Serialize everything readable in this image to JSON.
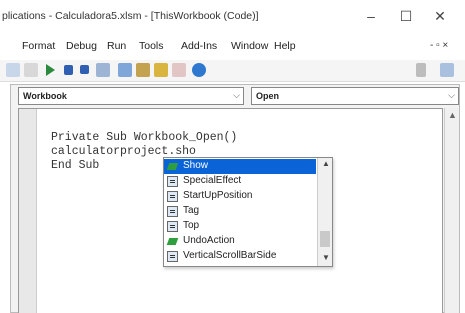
{
  "window": {
    "title": "plications - Calculadora5.xlsm - [ThisWorkbook (Code)]",
    "minimize": "–",
    "maximize": "☐",
    "close": "✕"
  },
  "menu": {
    "items": [
      "Format",
      "Debug",
      "Run",
      "Tools",
      "Add-Ins",
      "Window",
      "Help"
    ],
    "mdi_controls": "- ▫ ×"
  },
  "toolbar": {
    "icons": [
      "undo-icon",
      "redo-icon",
      "run-icon",
      "break-icon",
      "reset-icon",
      "design-mode-icon",
      "project-explorer-icon",
      "properties-icon",
      "object-browser-icon",
      "toolbox-icon",
      "help-icon"
    ]
  },
  "code_window": {
    "object_combo": "Workbook",
    "procedure_combo": "Open",
    "lines": [
      "Private Sub Workbook_Open()",
      "calculatorproject.sho",
      "End Sub"
    ]
  },
  "intellisense": {
    "items": [
      {
        "label": "Show",
        "kind": "method",
        "selected": true
      },
      {
        "label": "SpecialEffect",
        "kind": "property",
        "selected": false
      },
      {
        "label": "StartUpPosition",
        "kind": "property",
        "selected": false
      },
      {
        "label": "Tag",
        "kind": "property",
        "selected": false
      },
      {
        "label": "Top",
        "kind": "property",
        "selected": false
      },
      {
        "label": "UndoAction",
        "kind": "method",
        "selected": false
      },
      {
        "label": "VerticalScrollBarSide",
        "kind": "property",
        "selected": false
      }
    ]
  },
  "colors": {
    "selection": "#0a64d8",
    "method_icon": "#2e9e3e"
  }
}
